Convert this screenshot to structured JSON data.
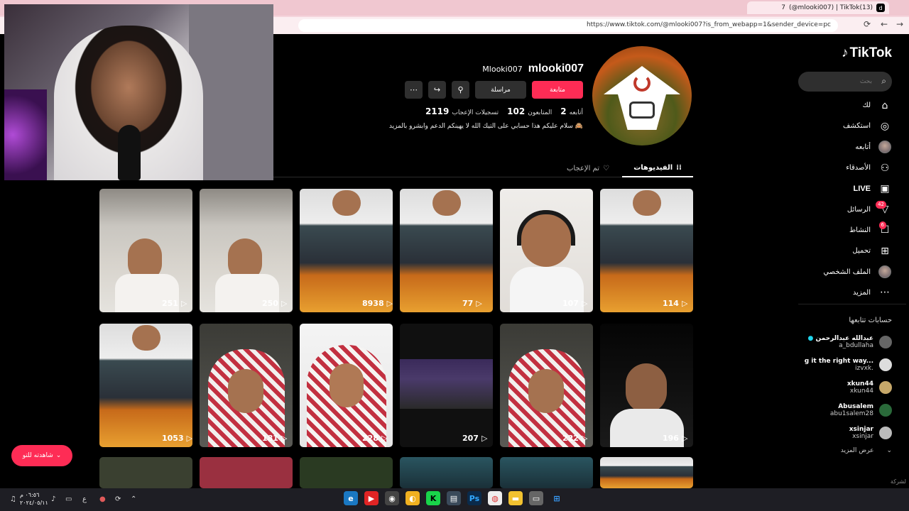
{
  "browser": {
    "tab_title": "(@mlooki007) | TikTok(13)",
    "tab_prefix": "7",
    "tab_icon": "d",
    "url": "https://www.tiktok.com/@mlooki007?is_from_webapp=1&sender_device=pc"
  },
  "sidebar": {
    "logo_text": "TikTok",
    "search_placeholder": "بحث",
    "items": [
      {
        "label": "لك",
        "icon": "home-icon"
      },
      {
        "label": "استكشف",
        "icon": "compass-icon"
      },
      {
        "label": "أتابعه",
        "icon": "avatar-icon"
      },
      {
        "label": "الأصدقاء",
        "icon": "friends-icon"
      },
      {
        "label": "LIVE",
        "icon": "live-icon"
      },
      {
        "label": "الرسائل",
        "icon": "messages-icon",
        "badge": "42"
      },
      {
        "label": "النشاط",
        "icon": "activity-icon",
        "badge": "6"
      },
      {
        "label": "تحميل",
        "icon": "upload-icon"
      },
      {
        "label": "الملف الشخصي",
        "icon": "profile-icon"
      },
      {
        "label": "المزيد",
        "icon": "more-icon"
      }
    ],
    "following_title": "حسابات تتابعها",
    "following": [
      {
        "name": "عبدالله عبدالرحمن",
        "handle": "a_bdullaha",
        "verified": true
      },
      {
        "name": "g it the right way...",
        "handle": "izvxk."
      },
      {
        "name": "xkun44",
        "handle": "xkun44"
      },
      {
        "name": "Abusalem",
        "handle": "abu1salem28"
      },
      {
        "name": "xsinjar",
        "handle": "xsinjar"
      }
    ],
    "show_more": "عرض المزيد",
    "company": "لشركة"
  },
  "profile": {
    "handle": "mlooki007",
    "nickname": "Mlooki007",
    "follow_label": "متابعة",
    "message_label": "مراسلة",
    "stats": [
      {
        "num": "2",
        "label": "أتابعه"
      },
      {
        "num": "102",
        "label": "المتابعون"
      },
      {
        "num": "2119",
        "label": "تسجيلات الإعجاب"
      }
    ],
    "bio": "سلام عليكم هذا حسابي على التيك الله لا يهينكم الدعم وابشرو بالمزيد 🙈"
  },
  "tabs": {
    "videos": "الفيديوهات",
    "liked": "تم الإعجاب"
  },
  "videos": [
    {
      "views": "114",
      "kind": "game"
    },
    {
      "views": "107",
      "kind": "head"
    },
    {
      "views": "77",
      "kind": "game"
    },
    {
      "views": "8938",
      "kind": "game"
    },
    {
      "views": "250",
      "kind": "car"
    },
    {
      "views": "251",
      "kind": "car"
    },
    {
      "views": "196",
      "kind": "night"
    },
    {
      "views": "222",
      "kind": "shemagh"
    },
    {
      "views": "207",
      "kind": "screen"
    },
    {
      "views": "228",
      "kind": "white"
    },
    {
      "views": "181",
      "kind": "shemagh"
    },
    {
      "views": "1053",
      "kind": "game"
    }
  ],
  "watch_button": "شاهدته للتو",
  "taskbar": {
    "time": "٠٦:٥٦ م",
    "date": "٢٠٢٤/٠٥/١١",
    "lang": "ع"
  }
}
